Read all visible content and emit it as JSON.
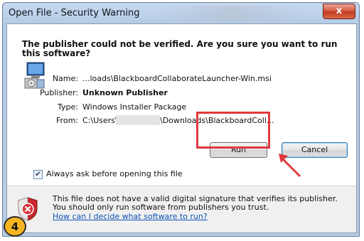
{
  "window": {
    "title": "Open File - Security Warning",
    "close_glyph": "x"
  },
  "dialog": {
    "heading": "The publisher could not be verified.  Are you sure you want to run this software?",
    "file_icon": "installer-package-icon",
    "details": [
      {
        "label": "Name:",
        "value": "...loads\\BlackboardCollaborateLauncher-Win.msi",
        "bold": false
      },
      {
        "label": "Publisher:",
        "value": "Unknown Publisher",
        "bold": true
      },
      {
        "label": "Type:",
        "value": "Windows Installer Package",
        "bold": false
      },
      {
        "label": "From:",
        "value_prefix": "C:\\Users\\",
        "value_suffix": "\\Downloads\\BlackboardColl...",
        "bold": false
      }
    ],
    "buttons": {
      "run": "Run",
      "cancel": "Cancel"
    },
    "checkbox": {
      "label": "Always ask before opening this file",
      "checked": true
    },
    "warning": {
      "icon": "security-shield-icon",
      "text": "This file does not have a valid digital signature that verifies its publisher.  You should only run software from publishers you trust.",
      "link": "How can I decide what software to run?"
    }
  },
  "annotation": {
    "step_number": "4",
    "highlight_color": "#e0393e",
    "badge_color": "#f7b521"
  }
}
